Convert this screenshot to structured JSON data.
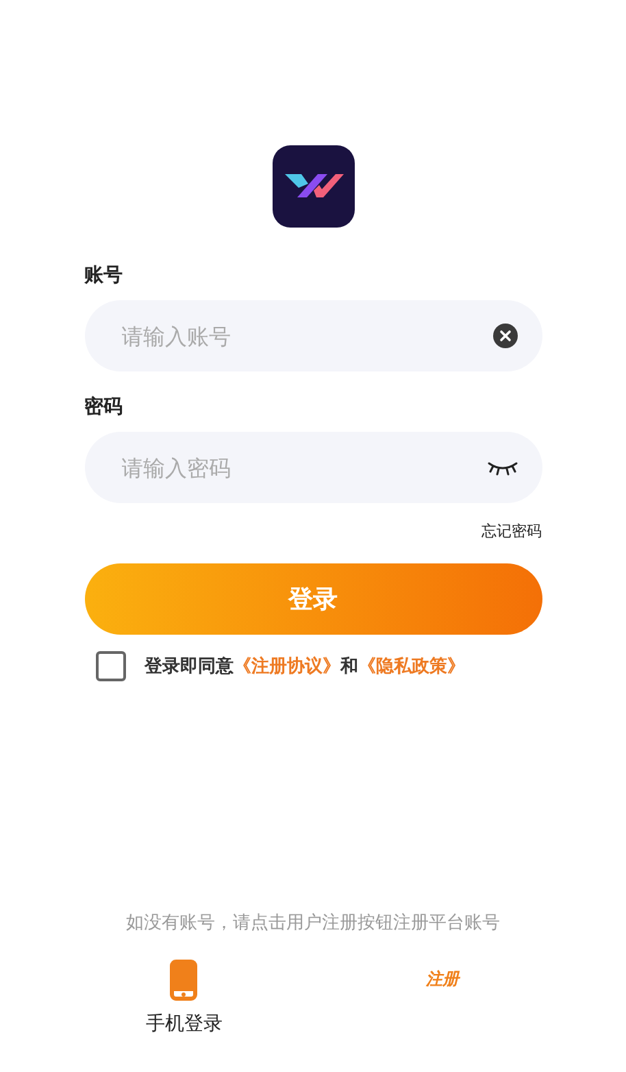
{
  "account": {
    "label": "账号",
    "placeholder": "请输入账号"
  },
  "password": {
    "label": "密码",
    "placeholder": "请输入密码"
  },
  "forgot_link": "忘记密码",
  "login_button": "登录",
  "agreement": {
    "checked": false,
    "prefix": "登录即同意",
    "terms": "《注册协议》",
    "joiner": "和",
    "privacy": "《隐私政策》"
  },
  "hint": "如没有账号，请点击用户注册按钮注册平台账号",
  "bottom_options": [
    {
      "kind": "phone",
      "label": "手机登录"
    },
    {
      "kind": "register",
      "badge": "注册"
    }
  ]
}
